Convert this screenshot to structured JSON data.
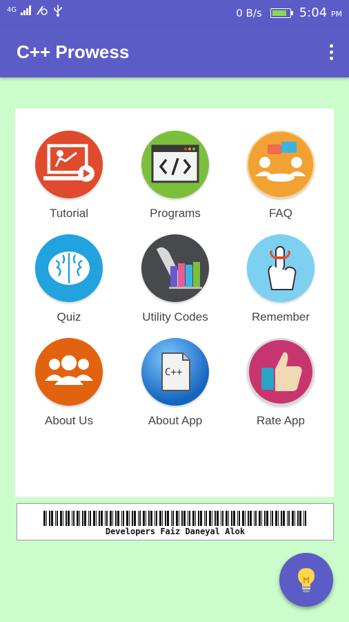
{
  "status_bar": {
    "network": "4G",
    "speed": "0 B/s",
    "time": "5:04",
    "ampm": "PM",
    "battery_level": 0.85
  },
  "app_bar": {
    "title": "C++ Prowess",
    "menu_icon": "overflow-menu-icon"
  },
  "tiles": [
    {
      "label": "Tutorial",
      "icon": "presentation-icon",
      "color": "#e04a2d"
    },
    {
      "label": "Programs",
      "icon": "code-window-icon",
      "color": "#7cbf3d"
    },
    {
      "label": "FAQ",
      "icon": "discussion-icon",
      "color": "#f2a133"
    },
    {
      "label": "Quiz",
      "icon": "brain-icon",
      "color": "#22a3dd"
    },
    {
      "label": "Utility Codes",
      "icon": "books-scroll-icon",
      "color": "#47494d"
    },
    {
      "label": "Remember",
      "icon": "finger-string-icon",
      "color": "#7ed0f0"
    },
    {
      "label": "About Us",
      "icon": "team-icon",
      "color": "#e2620f"
    },
    {
      "label": "About App",
      "icon": "cpp-file-icon",
      "color": "#1976c8"
    },
    {
      "label": "Rate App",
      "icon": "thumbs-up-icon",
      "color": "#c8356e"
    }
  ],
  "banner": {
    "text": "Developers Faiz Daneyal Alok"
  },
  "fab": {
    "icon": "lightbulb-icon"
  },
  "colors": {
    "primary": "#5b5cc6",
    "background": "#ccfccc"
  }
}
